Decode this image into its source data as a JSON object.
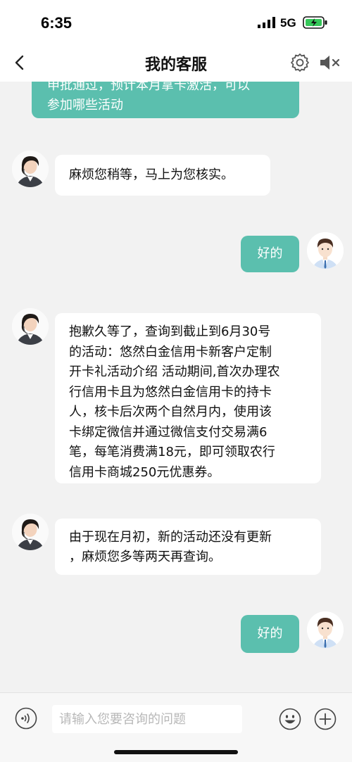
{
  "status_bar": {
    "time": "6:35",
    "network": "5G"
  },
  "header": {
    "title": "我的客服"
  },
  "messages": [
    {
      "side": "right",
      "lines": [
        "申批通过，预计本月拿卡激活，可以",
        "参加哪些活动"
      ]
    },
    {
      "side": "left",
      "lines": [
        "麻烦您稍等，马上为您核实。"
      ]
    },
    {
      "side": "right",
      "lines": [
        "好的"
      ]
    },
    {
      "side": "left",
      "lines": [
        "抱歉久等了，查询到截止到6月30号",
        "的活动：悠然白金信用卡新客户定制",
        "开卡礼活动介绍 活动期间,首次办理农",
        "行信用卡且为悠然白金信用卡的持卡",
        "人，核卡后次两个自然月内，使用该",
        "卡绑定微信并通过微信支付交易满6",
        "笔，每笔消费满18元，即可领取农行",
        "信用卡商城250元优惠券。"
      ]
    },
    {
      "side": "left",
      "lines": [
        "由于现在月初，新的活动还没有更新",
        "，麻烦您多等两天再查询。"
      ]
    },
    {
      "side": "right",
      "lines": [
        "好的"
      ]
    }
  ],
  "input": {
    "placeholder": "请输入您要咨询的问题"
  },
  "colors": {
    "accent": "#5bbfae",
    "background": "#f2f2f2",
    "bubble_agent": "#ffffff"
  }
}
